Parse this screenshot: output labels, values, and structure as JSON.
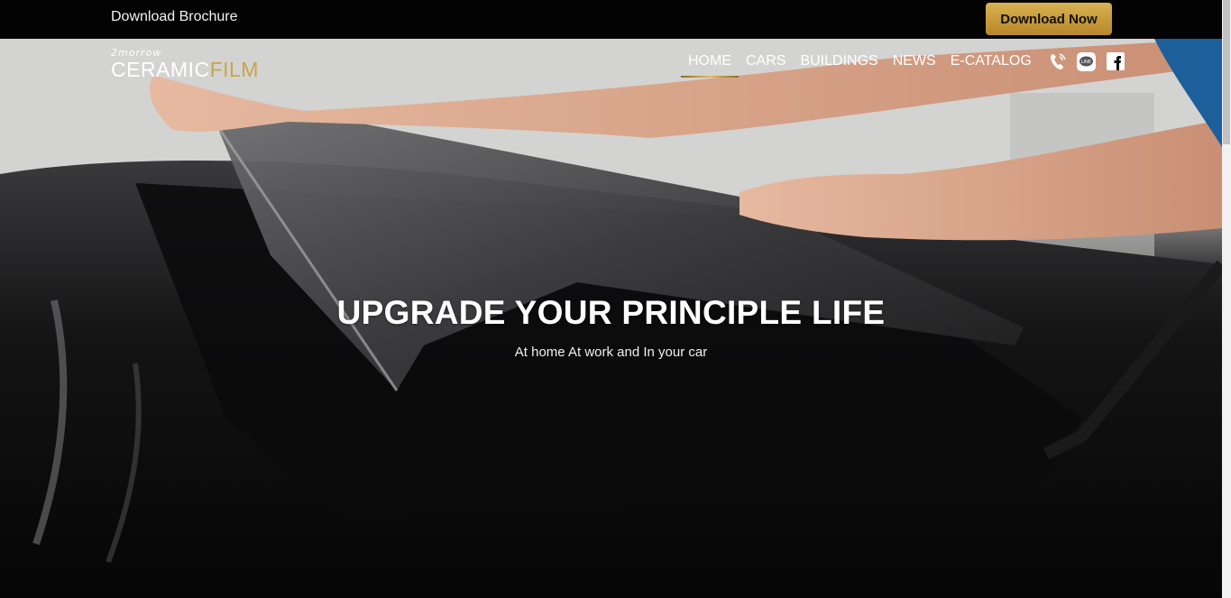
{
  "topbar": {
    "brochure_label": "Download Brochure",
    "download_button": "Download Now"
  },
  "logo": {
    "small_text": "2morrow",
    "word_white": "CERAMIC",
    "word_gold": "FILM"
  },
  "nav": {
    "items": [
      {
        "label": "HOME",
        "active": true
      },
      {
        "label": "CARS",
        "active": false
      },
      {
        "label": "BUILDINGS",
        "active": false
      },
      {
        "label": "NEWS",
        "active": false
      },
      {
        "label": "E-CATALOG",
        "active": false
      }
    ],
    "icons": [
      "phone-icon",
      "line-icon",
      "facebook-icon"
    ]
  },
  "hero": {
    "title": "UPGRADE YOUR PRINCIPLE LIFE",
    "subtitle": "At home At work and In your car"
  },
  "colors": {
    "accent_gold": "#c9a44e",
    "topbar_bg": "#030303",
    "button_gold": "#d1a847"
  }
}
